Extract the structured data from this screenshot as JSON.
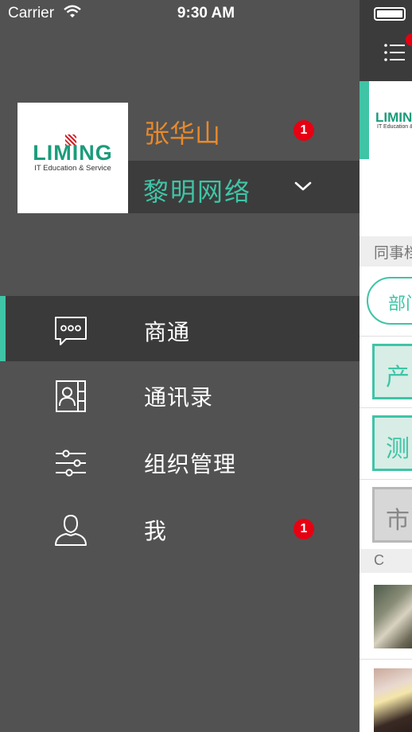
{
  "status_bar": {
    "carrier": "Carrier",
    "time": "9:30 AM"
  },
  "profile": {
    "logo_text": "LIMING",
    "logo_subtitle": "IT Education & Service",
    "user_name": "张华山",
    "user_badge": "1",
    "org_name": "黎明网络"
  },
  "menu": {
    "items": [
      {
        "label": "商通",
        "icon": "message-icon",
        "active": true
      },
      {
        "label": "通讯录",
        "icon": "contacts-icon",
        "active": false
      },
      {
        "label": "组织管理",
        "icon": "sliders-icon",
        "active": false
      },
      {
        "label": "我",
        "icon": "user-icon",
        "active": false,
        "badge": "1"
      }
    ]
  },
  "background_screen": {
    "nav_icon": "list-icon",
    "section_header": "同事档",
    "dept_button": "部门",
    "dept_rows": [
      "产",
      "测",
      "市"
    ],
    "letter_header": "C"
  },
  "colors": {
    "accent": "#3fc4a6",
    "name": "#e8892a",
    "badge": "#e60012",
    "drawer_bg": "#525252",
    "active_bg": "#3a3a3a"
  }
}
